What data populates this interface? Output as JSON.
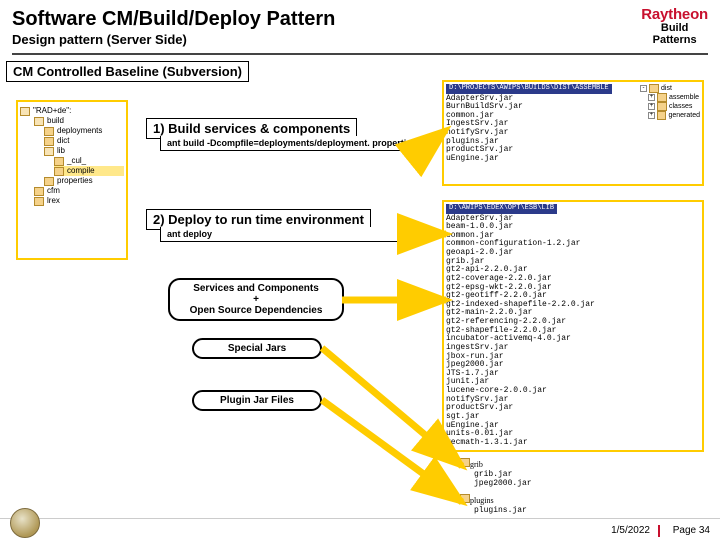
{
  "header": {
    "title": "Software CM/Build/Deploy Pattern",
    "subtitle": "Design pattern (Server Side)",
    "logo": "Raytheon",
    "badge_l1": "Build",
    "badge_l2": "Patterns"
  },
  "cm_box": "CM Controlled Baseline (Subversion)",
  "tree": {
    "root": "\"RAD+de\":",
    "items": [
      {
        "lvl": 1,
        "label": "build",
        "open": true
      },
      {
        "lvl": 2,
        "label": "deployments"
      },
      {
        "lvl": 2,
        "label": "dict"
      },
      {
        "lvl": 2,
        "label": "lib",
        "open": true
      },
      {
        "lvl": 3,
        "label": "_cul_"
      },
      {
        "lvl": 3,
        "label": "compile",
        "sel": true
      },
      {
        "lvl": 2,
        "label": "properties"
      },
      {
        "lvl": 1,
        "label": "cfm"
      },
      {
        "lvl": 1,
        "label": "lrex"
      }
    ]
  },
  "steps": {
    "s1_title": "1) Build services & components",
    "s1_cmd": "ant build -Dcompfile=deployments/deployment. properties",
    "s2_title": "2) Deploy to run time environment",
    "s2_cmd": "ant deploy"
  },
  "boxes": {
    "a1": "Services and Components",
    "a2": "+",
    "a3": "Open Source Dependencies",
    "b": "Special Jars",
    "c": "Plugin Jar Files"
  },
  "panels": {
    "a_title": "D:\\PROJECTS\\AWIPS\\BUILDS\\DIST\\ASSEMBLE",
    "a_list": [
      "AdapterSrv.jar",
      "BurnBuildSrv.jar",
      "common.jar",
      "IngestSrv.jar",
      "notifySrv.jar",
      "plugins.jar",
      "productSrv.jar",
      "uEngine.jar"
    ],
    "a_tree": [
      "dist",
      "assemble",
      "classes",
      "generated"
    ],
    "b_title": "D:\\AWIPS\\EDEX\\OPT\\ESB\\LIB",
    "b_list": [
      "AdapterSrv.jar",
      "beam-1.0.0.jar",
      "common.jar",
      "common-configuration-1.2.jar",
      "geoapi-2.0.jar",
      "grib.jar",
      "gt2-api-2.2.0.jar",
      "gt2-coverage-2.2.0.jar",
      "gt2-epsg-wkt-2.2.0.jar",
      "gt2-geotiff-2.2.0.jar",
      "gt2-indexed-shapefile-2.2.0.jar",
      "gt2-main-2.2.0.jar",
      "gt2-referencing-2.2.0.jar",
      "gt2-shapefile-2.2.0.jar",
      "incubator-activemq-4.0.jar",
      "ingestSrv.jar",
      "jbox-run.jar",
      "jpeg2000.jar",
      "JTS-1.7.jar",
      "junit.jar",
      "lucene-core-2.0.0.jar",
      "notifySrv.jar",
      "productSrv.jar",
      "sgt.jar",
      "uEngine.jar",
      "units-0.01.jar",
      "vecmath-1.3.1.jar"
    ],
    "sub1_name": "grib",
    "sub1_items": [
      "grib.jar",
      "jpeg2000.jar"
    ],
    "sub2_name": "plugins",
    "sub2_items": [
      "plugins.jar"
    ]
  },
  "footer": {
    "date": "1/5/2022",
    "page": "Page 34"
  }
}
